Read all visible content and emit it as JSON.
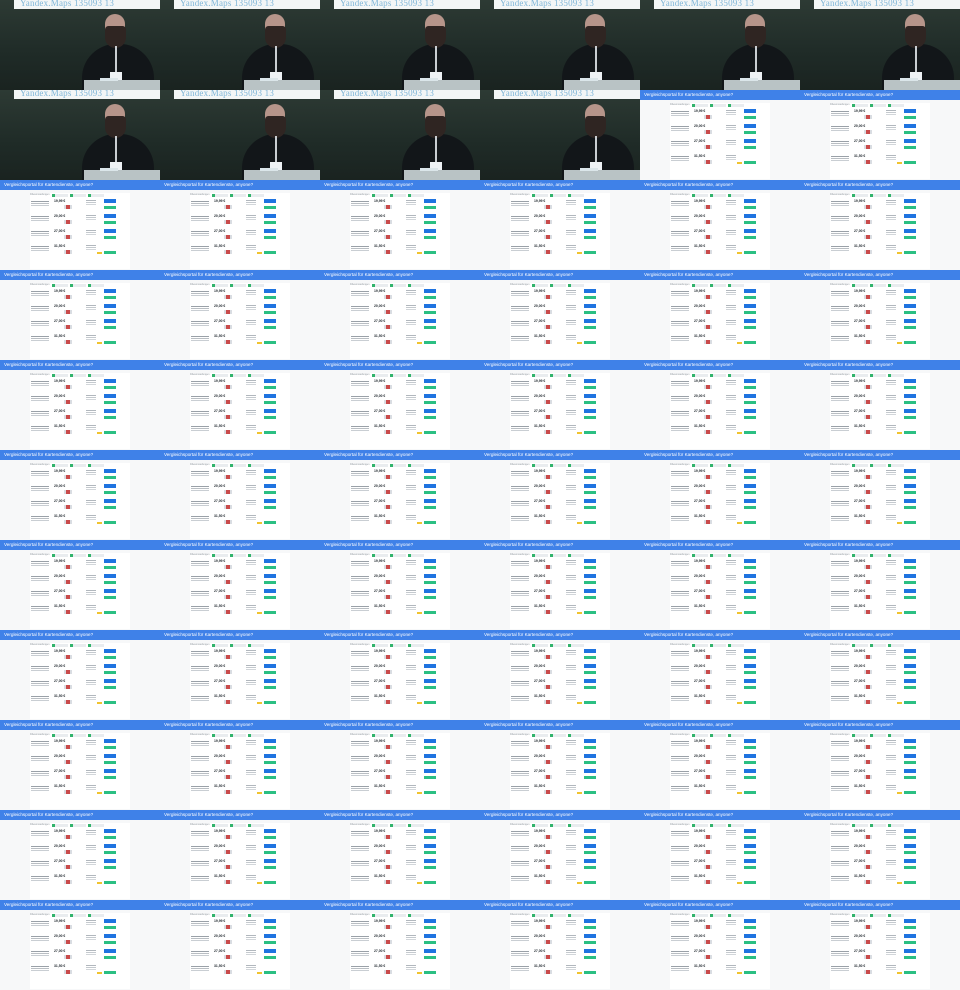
{
  "contact_sheet": {
    "columns": 6,
    "rows": 11,
    "speaker_frame_count": 10,
    "slide_frame_count": 56
  },
  "speaker_frame": {
    "projection_text": "Yandex.Maps  135093  13"
  },
  "slide_frame": {
    "header_title": "Vergleichsportal für Kartendienste, anyone?",
    "filter_label": "Filtereinstellungen",
    "prices": [
      "19,99 €",
      "20,00 €",
      "27,00 €",
      "31,50 €"
    ]
  },
  "colors": {
    "slide_header": "#3f81e8",
    "blue_button": "#1f73e0",
    "green_button": "#2bbf83",
    "yellow_tag": "#f0c330",
    "speaker_background": "#22292b"
  }
}
